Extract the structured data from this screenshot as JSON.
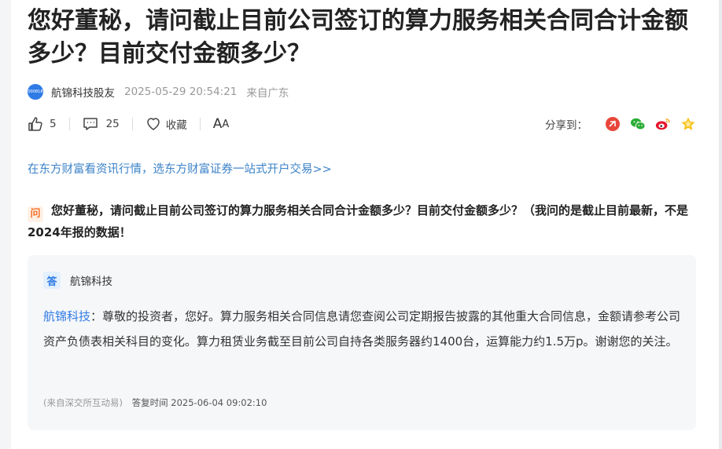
{
  "article": {
    "title": "您好董秘，请问截止目前公司签订的算力服务相关合同合计金额多少？目前交付金额多少？",
    "logo_text": "000818",
    "author": "航锦科技股友",
    "time": "2025-05-29 20:54:21",
    "location": "来自广东"
  },
  "actions": {
    "likes": "5",
    "comments": "25",
    "favorite_label": "收藏",
    "font_big": "A",
    "font_small": "A",
    "share_label": "分享到："
  },
  "promo": "在东方财富看资讯行情，选东方财富证券一站式开户交易>>",
  "question": {
    "badge": "问",
    "text": "您好董秘，请问截止目前公司签订的算力服务相关合同合计金额多少？目前交付金额多少？（我问的是截止目前最新，不是2024年报的数据！"
  },
  "answer": {
    "badge": "答",
    "company": "航锦科技",
    "name_prefix": "航锦科技",
    "text": "：尊敬的投资者，您好。算力服务相关合同信息请您查阅公司定期报告披露的其他重大合同信息，金额请参考公司资产负债表相关科目的变化。算力租赁业务截至目前公司自持各类服务器约1400台，运算能力约1.5万p。谢谢您的关注。",
    "source": "(来自深交所互动易)",
    "reply_time": "答复时间 2025-06-04 09:02:10"
  },
  "colors": {
    "accent_blue": "#2f7be5",
    "promo_blue": "#3b82c8",
    "question_orange": "#f5732d"
  },
  "icons": [
    "thumbs-up-icon",
    "comment-icon",
    "heart-icon",
    "toutiao-share-icon",
    "wechat-share-icon",
    "weibo-share-icon",
    "favorite-star-share-icon"
  ]
}
